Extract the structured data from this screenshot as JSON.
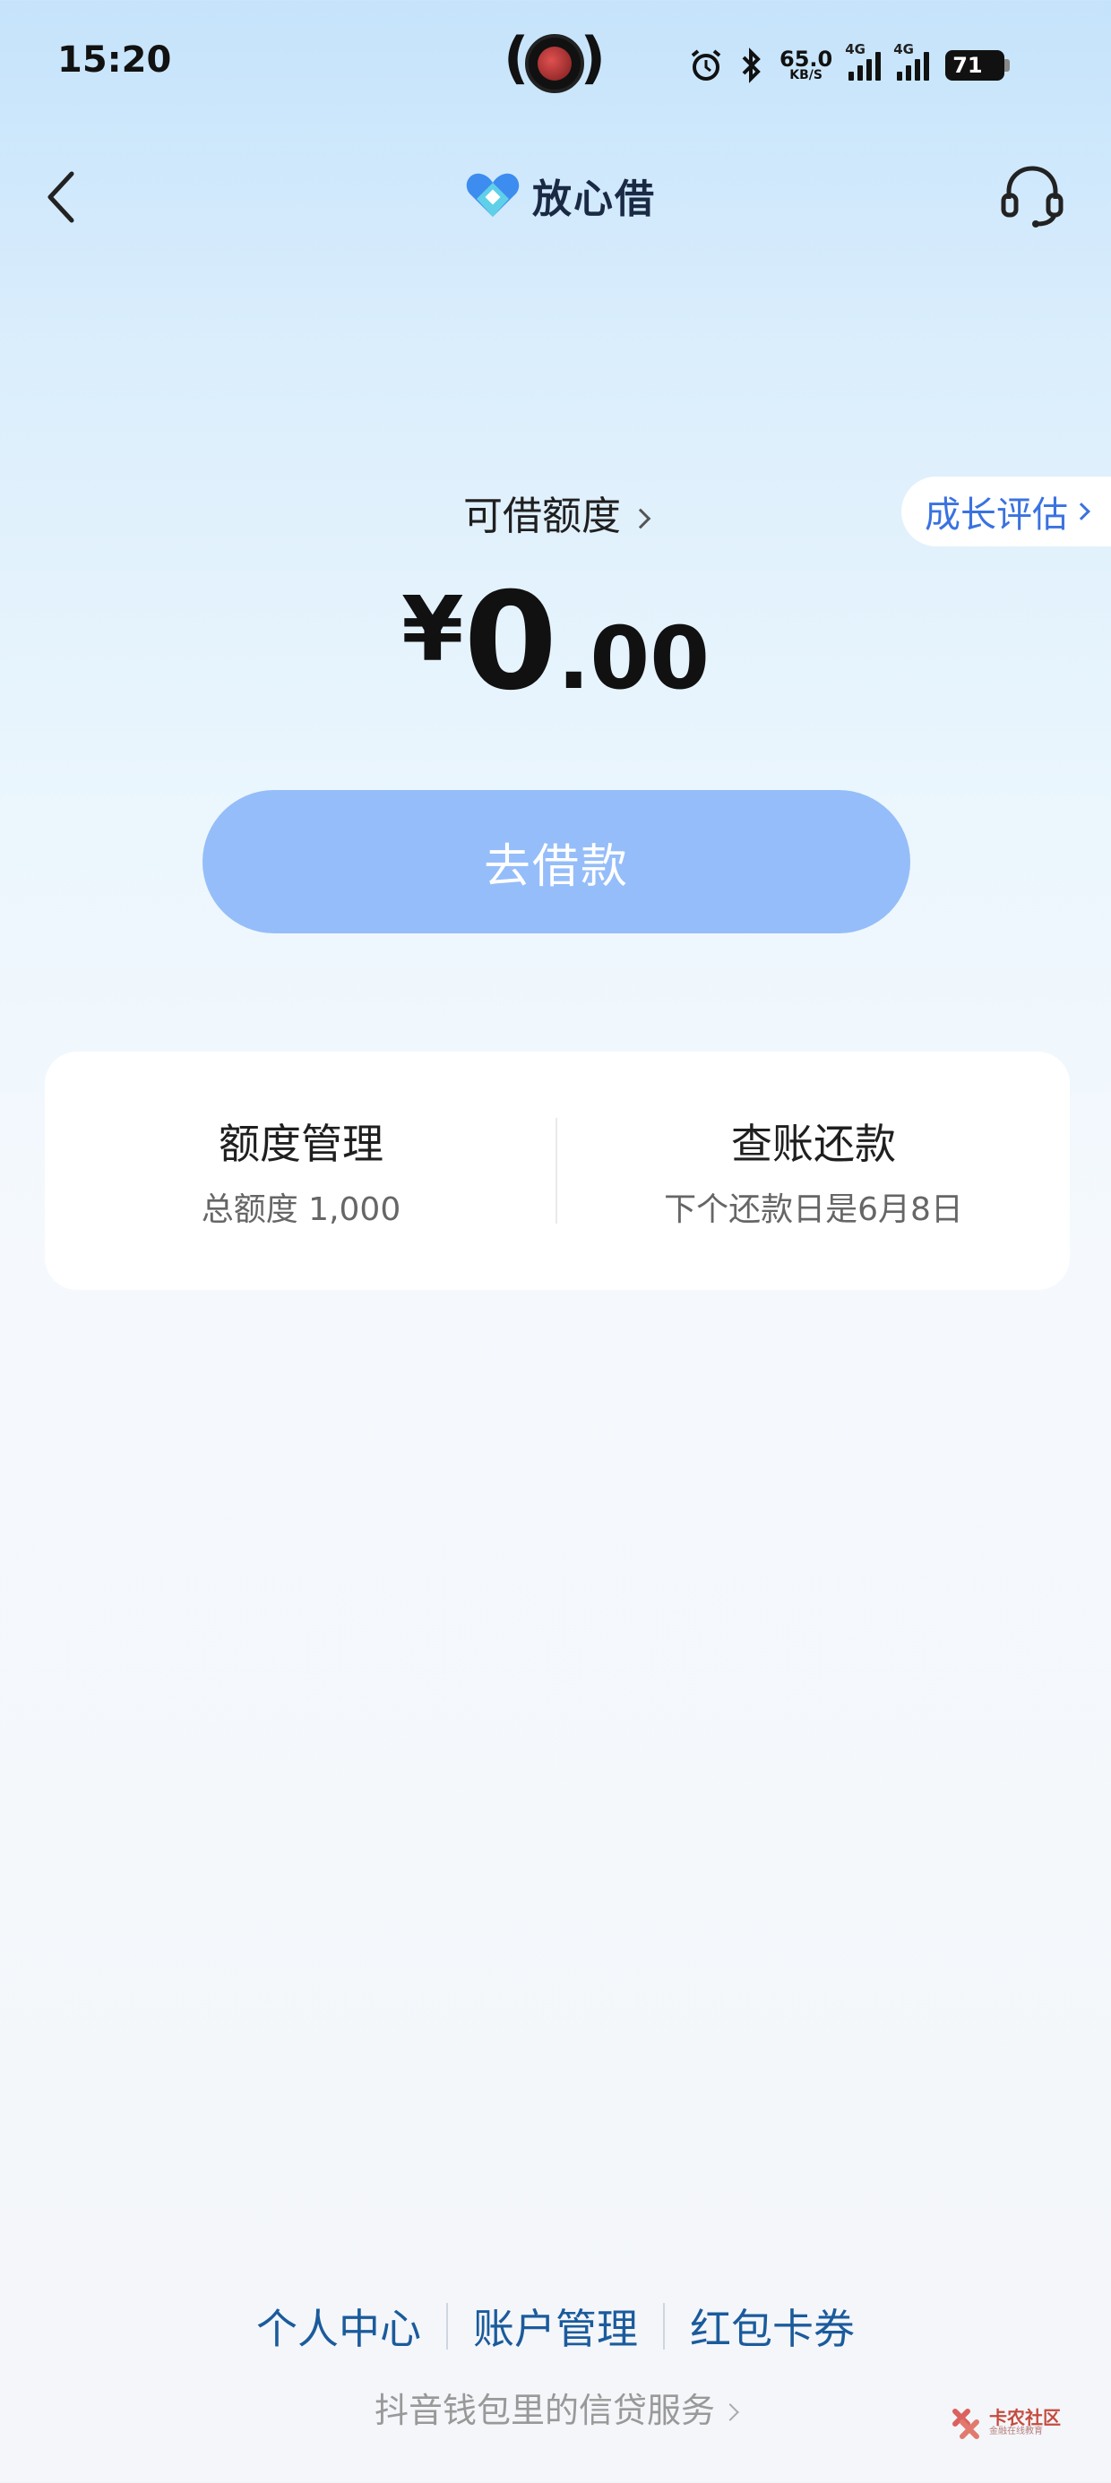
{
  "status_bar": {
    "time": "15:20",
    "net_speed_value": "65.0",
    "net_speed_unit": "KB/S",
    "signal_tag_1": "4G",
    "signal_tag_2": "4G",
    "battery": "71"
  },
  "nav": {
    "back_icon": "chevron-left-icon",
    "brand_name": "放心借",
    "service_icon": "headset-icon"
  },
  "credit": {
    "label": "可借额度",
    "growth_label": "成长评估",
    "currency": "¥",
    "amount_int": "0",
    "amount_dec": ".00"
  },
  "borrow_button": {
    "label": "去借款"
  },
  "card": {
    "left": {
      "title": "额度管理",
      "subtitle": "总额度 1,000"
    },
    "right": {
      "title": "查账还款",
      "subtitle": "下个还款日是6月8日"
    }
  },
  "bottom": {
    "links": [
      "个人中心",
      "账户管理",
      "红包卡券"
    ],
    "note": "抖音钱包里的信贷服务"
  },
  "watermark": {
    "text": "卡农社区",
    "sub": "金融在线教育"
  },
  "colors": {
    "accent": "#3a72e0",
    "button_bg": "#95bdf9",
    "link": "#1b5b9c"
  }
}
